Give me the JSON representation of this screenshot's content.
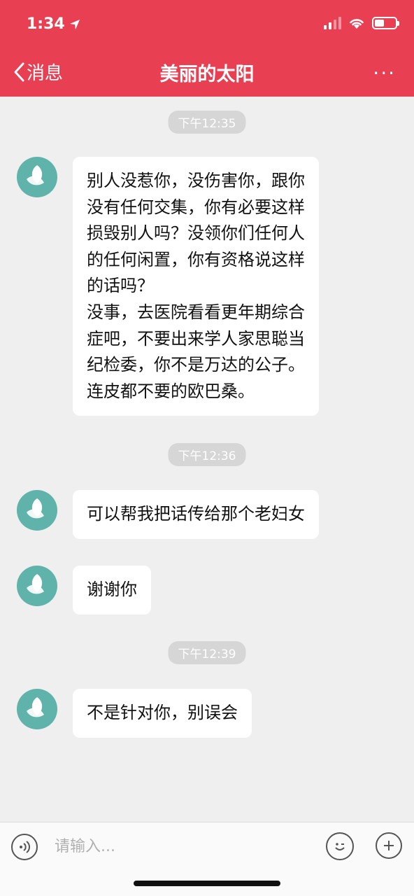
{
  "status_bar": {
    "time": "1:34",
    "battery_level": 0.45
  },
  "nav": {
    "back_label": "消息",
    "title": "美丽的太阳",
    "more_label": "···"
  },
  "messages": [
    {
      "time": "下午12:35",
      "lines": [
        "别人没惹你，没伤害你，跟你",
        "没有任何交集，你有必要这样",
        "损毁别人吗？没领你们任何人",
        "的任何闲置，你有资格说这样",
        "的话吗？",
        "没事，去医院看看更年期综合",
        "症吧，不要出来学人家思聪当",
        "纪检委，你不是万达的公子。",
        "连皮都不要的欧巴桑。"
      ]
    },
    {
      "time": "下午12:36",
      "lines": [
        "可以帮我把话传给那个老妇女"
      ]
    },
    {
      "lines": [
        "谢谢你"
      ]
    },
    {
      "time": "下午12:39",
      "lines": [
        "不是针对你，别误会"
      ]
    }
  ],
  "input": {
    "placeholder": "请输入..."
  },
  "icons": {
    "voice": "voice-icon",
    "emoji": "emoji-icon",
    "add": "plus-icon",
    "avatar": "leaf-avatar-icon"
  },
  "colors": {
    "header": "#e83f53",
    "avatar": "#5fb3aa",
    "background": "#efefef"
  }
}
